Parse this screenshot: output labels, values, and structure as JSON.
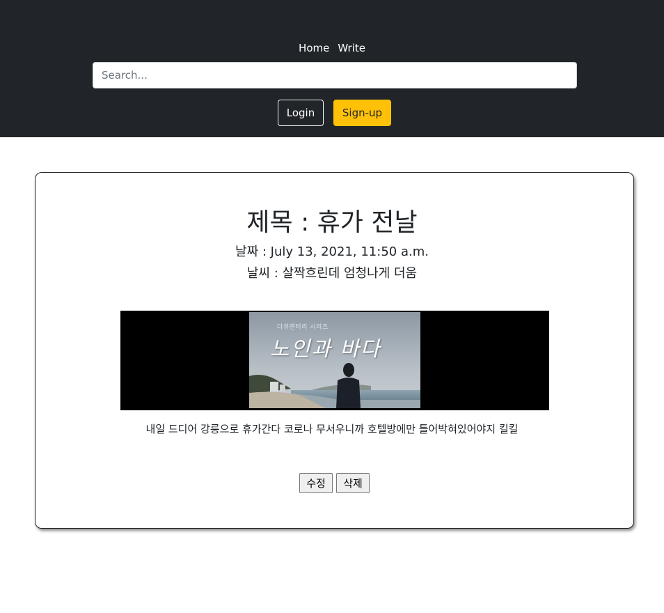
{
  "nav": {
    "links": [
      "Home",
      "Write"
    ],
    "search": {
      "placeholder": "Search...",
      "value": ""
    },
    "login_label": "Login",
    "signup_label": "Sign-up"
  },
  "post": {
    "title": "제목 : 휴가 전날",
    "date": "날짜 : July 13, 2021, 11:50 a.m.",
    "weather": "날씨 : 살짝흐린데 엄청나게 더움",
    "video": {
      "overlay_small": "다큐멘터리 시리즈",
      "overlay_title": "노인과 바다"
    },
    "content": "내일 드디어 강릉으로 휴가간다 코로나 무서우니까 호텔방에만 틀어박혀있어야지 킬킬",
    "edit_label": "수정",
    "delete_label": "삭제"
  },
  "colors": {
    "navbar_bg": "#212529",
    "signup_bg": "#ffc107"
  }
}
